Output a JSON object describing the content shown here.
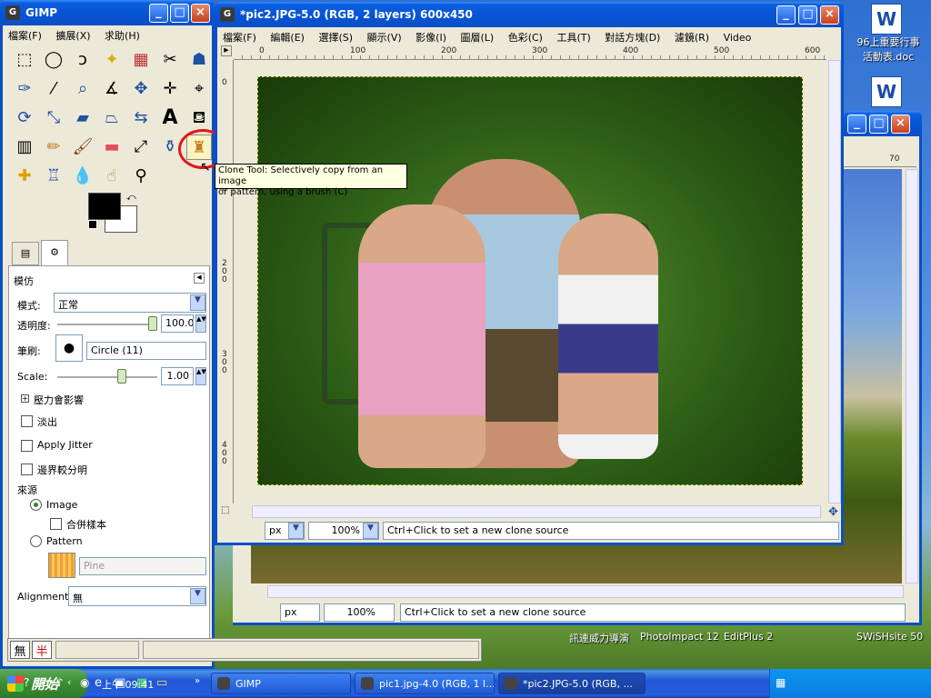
{
  "desktop": {
    "icons": [
      {
        "label_line1": "96上重要行事",
        "label_line2": "活動表.doc",
        "icon": "word-doc-icon"
      },
      {
        "label_line1": "",
        "label_line2": "",
        "icon": "word-doc-icon"
      }
    ],
    "launcher_labels": [
      "訊連威力導演",
      "PhotoImpact 12",
      "EditPlus 2",
      "SWiSHsite 50"
    ]
  },
  "toolbox": {
    "title": "GIMP",
    "menu": [
      "檔案(F)",
      "擴展(X)",
      "求助(H)"
    ],
    "options": {
      "title": "模仿",
      "mode_label": "模式:",
      "mode_value": "正常",
      "opacity_label": "透明度:",
      "opacity_value": "100.0",
      "brush_label": "筆刷:",
      "brush_value": "Circle (11)",
      "scale_label": "Scale:",
      "scale_value": "1.00",
      "pressure_label": "壓力會影響",
      "fade_label": "淡出",
      "jitter_label": "Apply Jitter",
      "hard_edge_label": "邊界較分明",
      "source_label": "來源",
      "source_image_label": "Image",
      "sample_merged_label": "合併樣本",
      "source_pattern_label": "Pattern",
      "pattern_value": "Pine",
      "alignment_label": "Alignment:",
      "alignment_value": "無"
    },
    "ime": {
      "mode": "無",
      "width": "半"
    }
  },
  "image_window": {
    "title": "*pic2.JPG-5.0 (RGB, 2 layers) 600x450",
    "menu": [
      "檔案(F)",
      "編輯(E)",
      "選擇(S)",
      "顯示(V)",
      "影像(I)",
      "圖層(L)",
      "色彩(C)",
      "工具(T)",
      "對話方塊(D)",
      "濾鏡(R)",
      "Video"
    ],
    "ruler_ticks": [
      "0",
      "100",
      "200",
      "300",
      "400",
      "500",
      "600"
    ],
    "vruler_ticks": [
      "0",
      "100",
      "200",
      "300",
      "400"
    ],
    "unit": "px",
    "zoom": "100%",
    "status": "Ctrl+Click to set a new clone source"
  },
  "tooltip": {
    "line1": "Clone Tool: Selectively copy from an image",
    "line2": "or pattern, using a brush  (C)"
  },
  "back_window": {
    "ruler_mark": "70",
    "unit": "px",
    "zoom": "100%",
    "status": "Ctrl+Click to set a new clone source"
  },
  "taskbar": {
    "start_label": "開始",
    "tasks": [
      {
        "label": "GIMP"
      },
      {
        "label": "pic1.jpg-4.0 (RGB, 1 l..."
      },
      {
        "label": "*pic2.JPG-5.0 (RGB, ..."
      }
    ],
    "clock": "上午 09:41"
  },
  "colors": {
    "accent": "#0a4fc4",
    "highlight_circle": "#e01818",
    "tooltip_bg": "#ffffe1"
  }
}
